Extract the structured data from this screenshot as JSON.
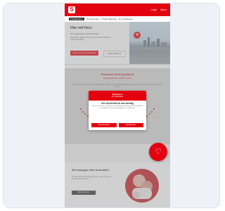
{
  "topbar": {
    "logo": "S",
    "links": [
      "Login",
      "Menu"
    ]
  },
  "navbar": {
    "items": [
      "Privatkunden",
      "Firmenkunden",
      "Private Banking",
      "Ihre Sparkasse"
    ]
  },
  "hero": {
    "title": "Hier mit Herz",
    "subtitle": "Ihre Sparkasse für Ihre Region",
    "text": "Persönlich, digital und immer für Sie da. Finanzen einfach erledigen.",
    "primary_button": "Jetzt Termin vereinbaren",
    "secondary_button": "Mehr erfahren"
  },
  "section": {
    "title": "Finanzen leicht gemacht",
    "subtitle": "Bankgeschäfte einfach digital",
    "text": "Mit unserer App und dem Online-Banking erledigen Sie Ihre Bankgeschäfte jederzeit und überall – bequem, sicher und schnell."
  },
  "fab": {
    "icon": "heart-icon",
    "symbol": "♡"
  },
  "bottom": {
    "title": "Wir bewegen Ihre Immobilie",
    "text": "Ob Kauf, Verkauf oder Finanzierung – unsere Experten begleiten Sie persönlich.",
    "button": "Mehr erfahren"
  },
  "cookie_modal": {
    "brand": "Sparkasse",
    "brand_sub": "Ihre Sparkasse",
    "title": "Ihre Sicherheit ist uns wichtig",
    "text": "Wir nutzen Cookies, um Ihnen die bestmögliche Nutzung unserer Webseite zu ermöglichen und unsere Angebote zu verbessern.",
    "accept_button": "Alle akzeptieren",
    "settings_button": "Einstellungen"
  },
  "colors": {
    "brand": "#e3000f",
    "overlay": "#969696"
  }
}
